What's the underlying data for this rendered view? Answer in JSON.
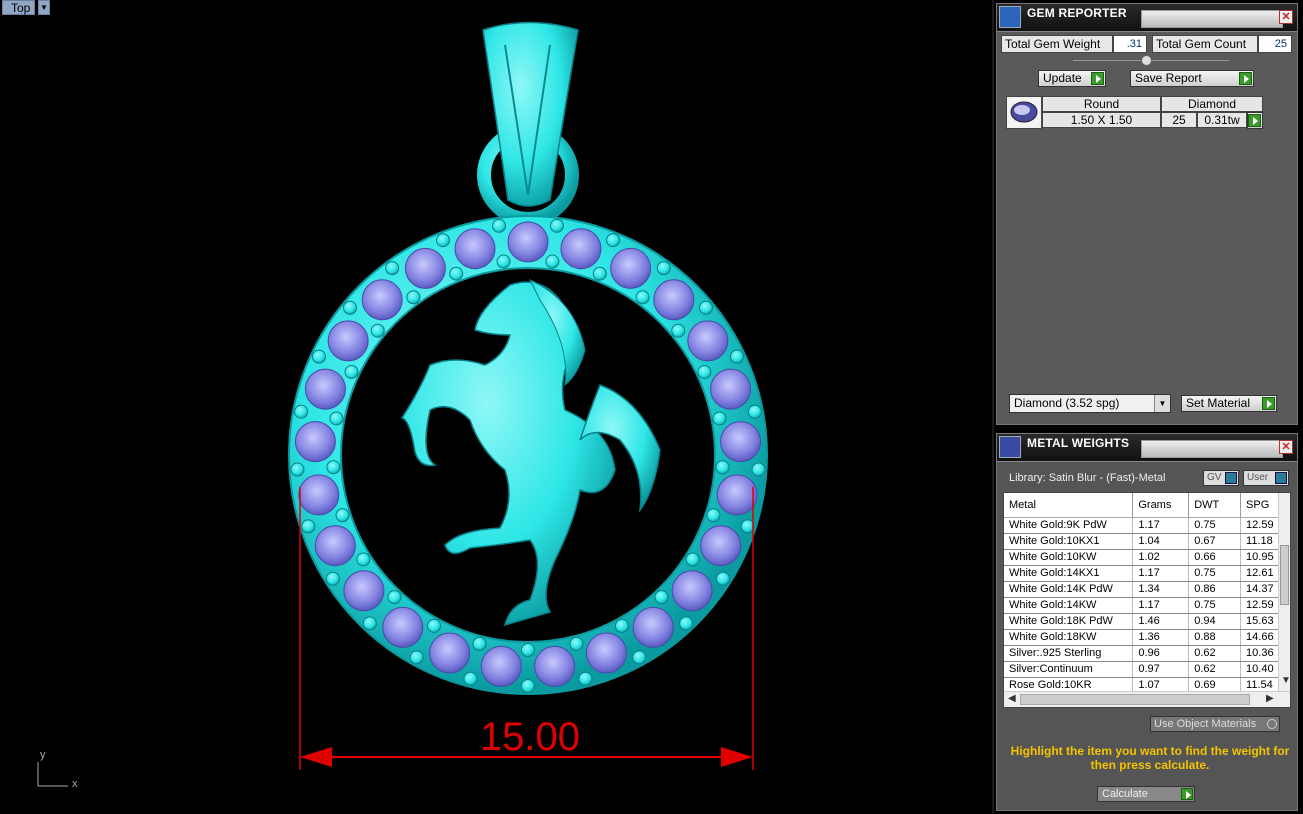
{
  "viewport": {
    "label": "Top",
    "dimension": "15.00",
    "axis_y": "y",
    "axis_x": "x",
    "colors": {
      "model": "#2ee6e6",
      "gem": "#7f7fe6",
      "dimension": "#e00000"
    }
  },
  "gem_reporter": {
    "title": "GEM REPORTER",
    "total_gem_weight_label": "Total Gem Weight",
    "total_gem_weight_value": ".31",
    "total_gem_count_label": "Total Gem Count",
    "total_gem_count_value": "25",
    "update_label": "Update",
    "save_report_label": "Save Report",
    "gem": {
      "shape": "Round",
      "type": "Diamond",
      "size": "1.50 X 1.50",
      "count": "25",
      "weight": "0.31tw"
    },
    "material_select": "Diamond    (3.52 spg)",
    "set_material_label": "Set Material"
  },
  "metal_weights": {
    "title": "METAL WEIGHTS",
    "library": "Library: Satin Blur - (Fast)-Metal",
    "gv_label": "GV",
    "user_label": "User",
    "columns": [
      "Metal",
      "Grams",
      "DWT",
      "SPG"
    ],
    "rows": [
      [
        "White Gold:9K PdW",
        "1.17",
        "0.75",
        "12.59"
      ],
      [
        "White Gold:10KX1",
        "1.04",
        "0.67",
        "11.18"
      ],
      [
        "White Gold:10KW",
        "1.02",
        "0.66",
        "10.95"
      ],
      [
        "White Gold:14KX1",
        "1.17",
        "0.75",
        "12.61"
      ],
      [
        "White Gold:14K PdW",
        "1.34",
        "0.86",
        "14.37"
      ],
      [
        "White Gold:14KW",
        "1.17",
        "0.75",
        "12.59"
      ],
      [
        "White Gold:18K PdW",
        "1.46",
        "0.94",
        "15.63"
      ],
      [
        "White Gold:18KW",
        "1.36",
        "0.88",
        "14.66"
      ],
      [
        "Silver:.925 Sterling",
        "0.96",
        "0.62",
        "10.36"
      ],
      [
        "Silver:Continuum",
        "0.97",
        "0.62",
        "10.40"
      ],
      [
        "Rose Gold:10KR",
        "1.07",
        "0.69",
        "11.54"
      ]
    ],
    "use_object_materials": "Use Object Materials",
    "hint": "Highlight the item you want to find the weight for then press calculate.",
    "calculate_label": "Calculate"
  }
}
